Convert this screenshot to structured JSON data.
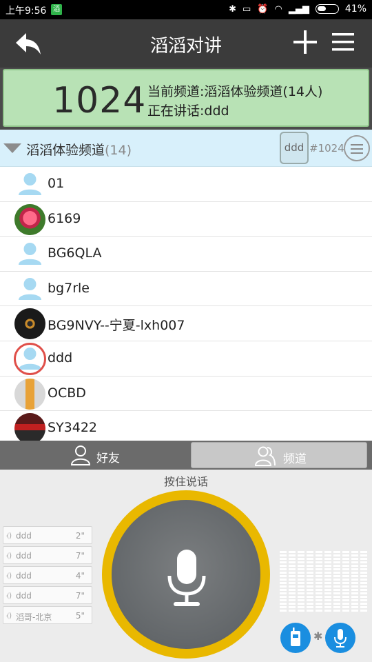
{
  "status_bar": {
    "time": "上午9:56",
    "app_badge": "滔",
    "battery": "41%"
  },
  "title_bar": {
    "title": "滔滔对讲"
  },
  "channel_info": {
    "channel_number": "1024",
    "current_label": "当前频道:",
    "current_value": "滔滔体验频道(14人)",
    "speaking_label": "正在讲话:",
    "speaking_value": "ddd"
  },
  "group": {
    "name": "滔滔体验频道",
    "count": "(14)",
    "talker": "ddd",
    "channel_id": "#1024"
  },
  "members": [
    {
      "name": "01",
      "avatar": "person-icon"
    },
    {
      "name": "6169",
      "avatar": "rose-photo"
    },
    {
      "name": "BG6QLA",
      "avatar": "person-icon"
    },
    {
      "name": "bg7rle",
      "avatar": "person-icon"
    },
    {
      "name": "BG9NVY--宁夏-lxh007",
      "avatar": "disc-photo"
    },
    {
      "name": "ddd",
      "avatar": "person-icon",
      "speaking": true
    },
    {
      "name": "OCBD",
      "avatar": "bottle-photo"
    },
    {
      "name": "SY3422",
      "avatar": "red-photo"
    }
  ],
  "tabs": {
    "friends": "好友",
    "channel": "频道"
  },
  "ptt": {
    "hint": "按住说话"
  },
  "history": [
    {
      "name": "ddd",
      "duration": "2\""
    },
    {
      "name": "ddd",
      "duration": "7\""
    },
    {
      "name": "ddd",
      "duration": "4\""
    },
    {
      "name": "ddd",
      "duration": "7\""
    },
    {
      "name": "滔哥-北京",
      "duration": "5\""
    }
  ],
  "colors": {
    "title_bar": "#3b3b3b",
    "info_panel": "#b8e2b5",
    "group_header": "#d8f0fb",
    "ptt_ring": "#e9b800",
    "bt_button": "#1a8ee0"
  }
}
